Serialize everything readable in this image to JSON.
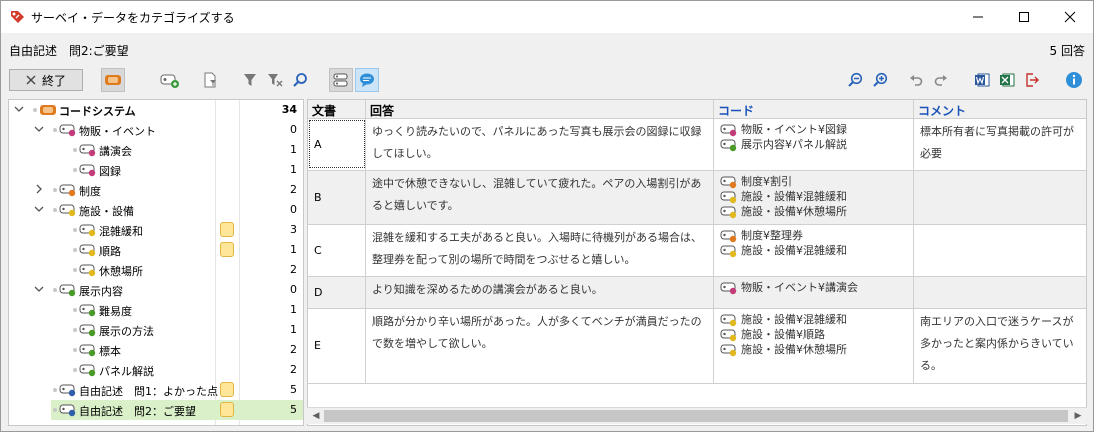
{
  "window": {
    "title": "サーベイ・データをカテゴライズする",
    "minimize_icon": "minimize-icon",
    "maximize_icon": "maximize-icon",
    "close_icon": "close-icon"
  },
  "header": {
    "title": "自由記述　問2:ご要望",
    "answer_count": "5 回答"
  },
  "toolbar": {
    "end_label": "終了",
    "tools": [
      "code-system-toggle-icon",
      "new-code-icon",
      "document-filter-icon",
      "filter-icon",
      "clear-filter-icon",
      "search-icon",
      "code-view-icon",
      "comment-view-icon",
      "zoom-out-icon",
      "zoom-in-icon",
      "undo-icon",
      "redo-icon",
      "word-export-icon",
      "excel-export-icon",
      "export-icon",
      "info-icon"
    ]
  },
  "tree": [
    {
      "label": "コードシステム",
      "count": "34",
      "level": 0,
      "color": "#e07a1f",
      "expanded": true,
      "bold": true,
      "memo": false
    },
    {
      "label": "物販・イベント",
      "count": "0",
      "level": 1,
      "color": "#c43b7a",
      "expanded": true,
      "memo": false
    },
    {
      "label": "講演会",
      "count": "1",
      "level": 2,
      "color": "#c43b7a",
      "memo": false
    },
    {
      "label": "図録",
      "count": "1",
      "level": 2,
      "color": "#c43b7a",
      "memo": false
    },
    {
      "label": "制度",
      "count": "2",
      "level": 1,
      "color": "#e07a1f",
      "collapsed": true,
      "memo": false
    },
    {
      "label": "施設・設備",
      "count": "0",
      "level": 1,
      "color": "#e2b81f",
      "expanded": true,
      "memo": false
    },
    {
      "label": "混雑緩和",
      "count": "3",
      "level": 2,
      "color": "#e2b81f",
      "memo": true
    },
    {
      "label": "順路",
      "count": "1",
      "level": 2,
      "color": "#e2b81f",
      "memo": true
    },
    {
      "label": "休憩場所",
      "count": "2",
      "level": 2,
      "color": "#e2b81f",
      "memo": false
    },
    {
      "label": "展示内容",
      "count": "0",
      "level": 1,
      "color": "#4a9a2a",
      "expanded": true,
      "memo": false
    },
    {
      "label": "難易度",
      "count": "1",
      "level": 2,
      "color": "#4a9a2a",
      "memo": false
    },
    {
      "label": "展示の方法",
      "count": "1",
      "level": 2,
      "color": "#4a9a2a",
      "memo": false
    },
    {
      "label": "標本",
      "count": "2",
      "level": 2,
      "color": "#4a9a2a",
      "memo": false
    },
    {
      "label": "パネル解説",
      "count": "2",
      "level": 2,
      "color": "#4a9a2a",
      "memo": false
    },
    {
      "label": "自由記述　問1：よかった点",
      "count": "5",
      "level": 1,
      "color": "#2e5fa8",
      "memo": true
    },
    {
      "label": "自由記述　問2：ご要望",
      "count": "5",
      "level": 1,
      "color": "#2e5fa8",
      "memo": true,
      "selected": true
    }
  ],
  "table": {
    "headers": {
      "doc": "文書",
      "answer": "回答",
      "code": "コード",
      "comment": "コメント"
    },
    "rows": [
      {
        "doc": "A",
        "answer": "ゆっくり読みたいので、パネルにあった写真も展示会の図録に収録してほしい。",
        "codes": [
          {
            "text": "物販・イベント¥図録",
            "color": "#c43b7a"
          },
          {
            "text": "展示内容¥パネル解説",
            "color": "#4a9a2a"
          }
        ],
        "comment": "標本所有者に写真掲載の許可が必要"
      },
      {
        "doc": "B",
        "answer": "途中で休憩できないし、混雑していて疲れた。ペアの入場割引があると嬉しいです。",
        "codes": [
          {
            "text": "制度¥割引",
            "color": "#e07a1f"
          },
          {
            "text": "施設・設備¥混雑緩和",
            "color": "#e2b81f"
          },
          {
            "text": "施設・設備¥休憩場所",
            "color": "#e2b81f"
          }
        ],
        "comment": ""
      },
      {
        "doc": "C",
        "answer": "混雑を緩和するエ夫があると良い。入場時に待機列がある場合は、整理券を配って別の場所で時間をつぶせると嬉しい。",
        "codes": [
          {
            "text": "制度¥整理券",
            "color": "#e07a1f"
          },
          {
            "text": "施設・設備¥混雑緩和",
            "color": "#e2b81f"
          }
        ],
        "comment": ""
      },
      {
        "doc": "D",
        "answer": "より知識を深めるための講演会があると良い。",
        "codes": [
          {
            "text": "物販・イベント¥講演会",
            "color": "#c43b7a"
          }
        ],
        "comment": ""
      },
      {
        "doc": "E",
        "answer": "順路が分かり辛い場所があった。人が多くてベンチが満員だったので数を増やして欲しい。",
        "codes": [
          {
            "text": "施設・設備¥混雑緩和",
            "color": "#e2b81f"
          },
          {
            "text": "施設・設備¥順路",
            "color": "#e2b81f"
          },
          {
            "text": "施設・設備¥休憩場所",
            "color": "#e2b81f"
          }
        ],
        "comment": "南エリアの入口で迷うケースが多かったと案内係からきいている。"
      }
    ]
  }
}
